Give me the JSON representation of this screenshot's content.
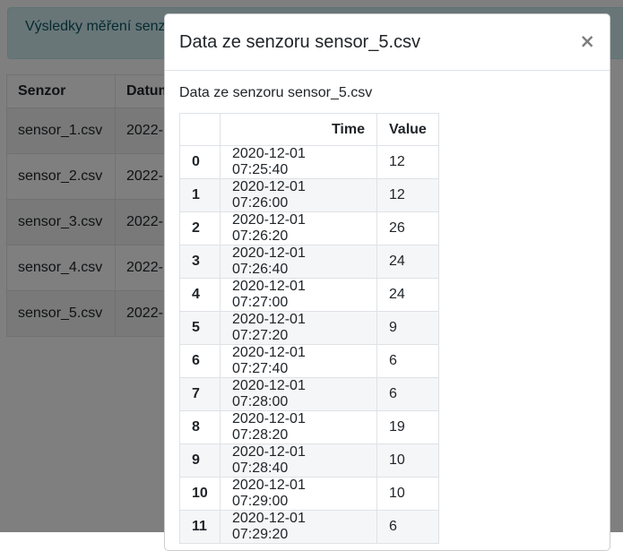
{
  "background": {
    "alert_text": "Výsledky měření senzorů",
    "table": {
      "headers": [
        "Senzor",
        "Datum"
      ],
      "rows": [
        {
          "sensor": "sensor_1.csv",
          "date": "2022-"
        },
        {
          "sensor": "sensor_2.csv",
          "date": "2022-"
        },
        {
          "sensor": "sensor_3.csv",
          "date": "2022-"
        },
        {
          "sensor": "sensor_4.csv",
          "date": "2022-"
        },
        {
          "sensor": "sensor_5.csv",
          "date": "2022-"
        }
      ]
    }
  },
  "modal": {
    "title": "Data ze senzoru sensor_5.csv",
    "close_label": "×",
    "caption": "Data ze senzoru sensor_5.csv",
    "table": {
      "headers": {
        "index": "",
        "time": "Time",
        "value": "Value"
      },
      "rows": [
        {
          "idx": "0",
          "time": "2020-12-01 07:25:40",
          "value": "12"
        },
        {
          "idx": "1",
          "time": "2020-12-01 07:26:00",
          "value": "12"
        },
        {
          "idx": "2",
          "time": "2020-12-01 07:26:20",
          "value": "26"
        },
        {
          "idx": "3",
          "time": "2020-12-01 07:26:40",
          "value": "24"
        },
        {
          "idx": "4",
          "time": "2020-12-01 07:27:00",
          "value": "24"
        },
        {
          "idx": "5",
          "time": "2020-12-01 07:27:20",
          "value": "9"
        },
        {
          "idx": "6",
          "time": "2020-12-01 07:27:40",
          "value": "6"
        },
        {
          "idx": "7",
          "time": "2020-12-01 07:28:00",
          "value": "6"
        },
        {
          "idx": "8",
          "time": "2020-12-01 07:28:20",
          "value": "19"
        },
        {
          "idx": "9",
          "time": "2020-12-01 07:28:40",
          "value": "10"
        },
        {
          "idx": "10",
          "time": "2020-12-01 07:29:00",
          "value": "10"
        },
        {
          "idx": "11",
          "time": "2020-12-01 07:29:20",
          "value": "6"
        }
      ]
    }
  }
}
